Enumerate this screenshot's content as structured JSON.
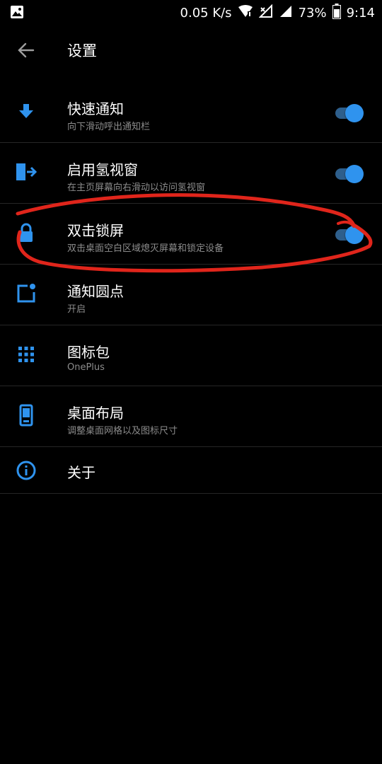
{
  "status_bar": {
    "speed": "0.05 K/s",
    "battery": "73%",
    "time": "9:14"
  },
  "app_bar": {
    "title": "设置",
    "back_icon": "arrow-back-icon"
  },
  "settings": [
    {
      "title": "快速通知",
      "subtitle": "向下滑动呼出通知栏",
      "icon": "arrow-down-icon",
      "toggle": true,
      "enabled": true
    },
    {
      "title": "启用氢视窗",
      "subtitle": "在主页屏幕向右滑动以访问氢视窗",
      "icon": "shelf-exit-icon",
      "toggle": true,
      "enabled": true
    },
    {
      "title": "双击锁屏",
      "subtitle": "双击桌面空白区域熄灭屏幕和锁定设备",
      "icon": "lock-icon",
      "toggle": true,
      "enabled": true
    },
    {
      "title": "通知圆点",
      "subtitle": "开启",
      "icon": "notification-dot-icon",
      "toggle": false
    },
    {
      "title": "图标包",
      "subtitle": "OnePlus",
      "icon": "grid-icon",
      "toggle": false
    },
    {
      "title": "桌面布局",
      "subtitle": "调整桌面网格以及图标尺寸",
      "icon": "phone-layout-icon",
      "toggle": false
    },
    {
      "title": "关于",
      "subtitle": "",
      "icon": "info-icon",
      "toggle": false
    }
  ],
  "colors": {
    "accent": "#2f93ee",
    "background": "#000000",
    "annotation": "#e0251b"
  }
}
